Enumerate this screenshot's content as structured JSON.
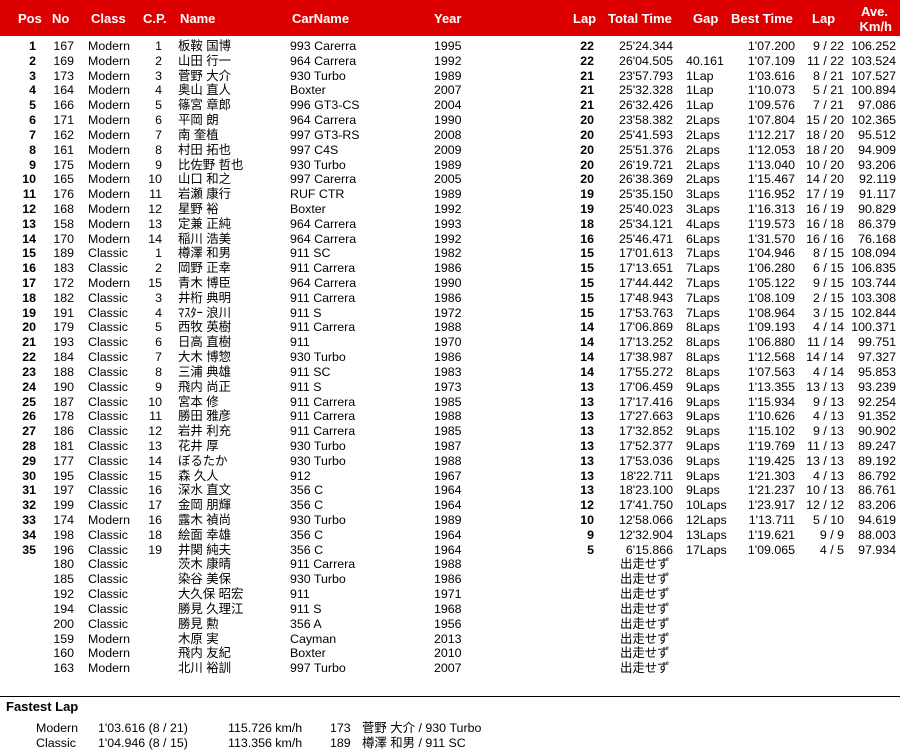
{
  "header": {
    "pos": "Pos",
    "no": "No",
    "class": "Class",
    "cp": "C.P.",
    "name": "Name",
    "car": "CarName",
    "year": "Year",
    "lap": "Lap",
    "total": "Total Time",
    "gap": "Gap",
    "best": "Best Time",
    "best_lap": "Lap",
    "ave1": "Ave.",
    "ave2": "Km/h"
  },
  "colors": {
    "header_bg": "#dd0000",
    "header_text": "#ffffff"
  },
  "rows": [
    {
      "pos": "1",
      "no": "167",
      "cls": "Modern",
      "cp": "1",
      "name": "板鞍 国博",
      "car": "993 Carerra",
      "year": "1995",
      "lap": "22",
      "total": "25'24.344",
      "gap": "",
      "best": "1'07.200",
      "lapn": "9 / 22",
      "ave": "106.252"
    },
    {
      "pos": "2",
      "no": "169",
      "cls": "Modern",
      "cp": "2",
      "name": "山田 行一",
      "car": "964 Carrera",
      "year": "1992",
      "lap": "22",
      "total": "26'04.505",
      "gap": "40.161",
      "best": "1'07.109",
      "lapn": "11 / 22",
      "ave": "103.524"
    },
    {
      "pos": "3",
      "no": "173",
      "cls": "Modern",
      "cp": "3",
      "name": "菅野 大介",
      "car": "930 Turbo",
      "year": "1989",
      "lap": "21",
      "total": "23'57.793",
      "gap": "1Lap",
      "best": "1'03.616",
      "lapn": "8 / 21",
      "ave": "107.527"
    },
    {
      "pos": "4",
      "no": "164",
      "cls": "Modern",
      "cp": "4",
      "name": "奥山 直人",
      "car": "Boxter",
      "year": "2007",
      "lap": "21",
      "total": "25'32.328",
      "gap": "1Lap",
      "best": "1'10.073",
      "lapn": "5 / 21",
      "ave": "100.894"
    },
    {
      "pos": "5",
      "no": "166",
      "cls": "Modern",
      "cp": "5",
      "name": "篠宮 章郎",
      "car": "996 GT3-CS",
      "year": "2004",
      "lap": "21",
      "total": "26'32.426",
      "gap": "1Lap",
      "best": "1'09.576",
      "lapn": "7 / 21",
      "ave": "97.086"
    },
    {
      "pos": "6",
      "no": "171",
      "cls": "Modern",
      "cp": "6",
      "name": "平岡 朗",
      "car": "964 Carrera",
      "year": "1990",
      "lap": "20",
      "total": "23'58.382",
      "gap": "2Laps",
      "best": "1'07.804",
      "lapn": "15 / 20",
      "ave": "102.365"
    },
    {
      "pos": "7",
      "no": "162",
      "cls": "Modern",
      "cp": "7",
      "name": "南 奎植",
      "car": "997 GT3-RS",
      "year": "2008",
      "lap": "20",
      "total": "25'41.593",
      "gap": "2Laps",
      "best": "1'12.217",
      "lapn": "18 / 20",
      "ave": "95.512"
    },
    {
      "pos": "8",
      "no": "161",
      "cls": "Modern",
      "cp": "8",
      "name": "村田 拓也",
      "car": "997 C4S",
      "year": "2009",
      "lap": "20",
      "total": "25'51.376",
      "gap": "2Laps",
      "best": "1'12.053",
      "lapn": "18 / 20",
      "ave": "94.909"
    },
    {
      "pos": "9",
      "no": "175",
      "cls": "Modern",
      "cp": "9",
      "name": "比佐野 哲也",
      "car": "930 Turbo",
      "year": "1989",
      "lap": "20",
      "total": "26'19.721",
      "gap": "2Laps",
      "best": "1'13.040",
      "lapn": "10 / 20",
      "ave": "93.206"
    },
    {
      "pos": "10",
      "no": "165",
      "cls": "Modern",
      "cp": "10",
      "name": "山口 和之",
      "car": "997 Carerra",
      "year": "2005",
      "lap": "20",
      "total": "26'38.369",
      "gap": "2Laps",
      "best": "1'15.467",
      "lapn": "14 / 20",
      "ave": "92.119"
    },
    {
      "pos": "11",
      "no": "176",
      "cls": "Modern",
      "cp": "11",
      "name": "岩瀬 康行",
      "car": "RUF CTR",
      "year": "1989",
      "lap": "19",
      "total": "25'35.150",
      "gap": "3Laps",
      "best": "1'16.952",
      "lapn": "17 / 19",
      "ave": "91.117"
    },
    {
      "pos": "12",
      "no": "168",
      "cls": "Modern",
      "cp": "12",
      "name": "星野 裕",
      "car": "Boxter",
      "year": "1992",
      "lap": "19",
      "total": "25'40.023",
      "gap": "3Laps",
      "best": "1'16.313",
      "lapn": "16 / 19",
      "ave": "90.829"
    },
    {
      "pos": "13",
      "no": "158",
      "cls": "Modern",
      "cp": "13",
      "name": "定兼 正純",
      "car": "964 Carrera",
      "year": "1993",
      "lap": "18",
      "total": "25'34.121",
      "gap": "4Laps",
      "best": "1'19.573",
      "lapn": "16 / 18",
      "ave": "86.379"
    },
    {
      "pos": "14",
      "no": "170",
      "cls": "Modern",
      "cp": "14",
      "name": "稲川 浩美",
      "car": "964 Carrera",
      "year": "1992",
      "lap": "16",
      "total": "25'46.471",
      "gap": "6Laps",
      "best": "1'31.570",
      "lapn": "16 / 16",
      "ave": "76.168"
    },
    {
      "pos": "15",
      "no": "189",
      "cls": "Classic",
      "cp": "1",
      "name": "樽澤 和男",
      "car": "911 SC",
      "year": "1982",
      "lap": "15",
      "total": "17'01.613",
      "gap": "7Laps",
      "best": "1'04.946",
      "lapn": "8 / 15",
      "ave": "108.094"
    },
    {
      "pos": "16",
      "no": "183",
      "cls": "Classic",
      "cp": "2",
      "name": "岡野 正幸",
      "car": "911 Carrera",
      "year": "1986",
      "lap": "15",
      "total": "17'13.651",
      "gap": "7Laps",
      "best": "1'06.280",
      "lapn": "6 / 15",
      "ave": "106.835"
    },
    {
      "pos": "17",
      "no": "172",
      "cls": "Modern",
      "cp": "15",
      "name": "青木 博臣",
      "car": "964 Carrera",
      "year": "1990",
      "lap": "15",
      "total": "17'44.442",
      "gap": "7Laps",
      "best": "1'05.122",
      "lapn": "9 / 15",
      "ave": "103.744"
    },
    {
      "pos": "18",
      "no": "182",
      "cls": "Classic",
      "cp": "3",
      "name": "井桁 典明",
      "car": "911 Carrera",
      "year": "1986",
      "lap": "15",
      "total": "17'48.943",
      "gap": "7Laps",
      "best": "1'08.109",
      "lapn": "2 / 15",
      "ave": "103.308"
    },
    {
      "pos": "19",
      "no": "191",
      "cls": "Classic",
      "cp": "4",
      "name": "ﾏｽﾀｰ 浪川",
      "car": "911 S",
      "year": "1972",
      "lap": "15",
      "total": "17'53.763",
      "gap": "7Laps",
      "best": "1'08.964",
      "lapn": "3 / 15",
      "ave": "102.844"
    },
    {
      "pos": "20",
      "no": "179",
      "cls": "Classic",
      "cp": "5",
      "name": "西牧 英樹",
      "car": "911 Carrera",
      "year": "1988",
      "lap": "14",
      "total": "17'06.869",
      "gap": "8Laps",
      "best": "1'09.193",
      "lapn": "4 / 14",
      "ave": "100.371"
    },
    {
      "pos": "21",
      "no": "193",
      "cls": "Classic",
      "cp": "6",
      "name": "日高 直樹",
      "car": "911",
      "year": "1970",
      "lap": "14",
      "total": "17'13.252",
      "gap": "8Laps",
      "best": "1'06.880",
      "lapn": "11 / 14",
      "ave": "99.751"
    },
    {
      "pos": "22",
      "no": "184",
      "cls": "Classic",
      "cp": "7",
      "name": "大木 博惣",
      "car": "930 Turbo",
      "year": "1986",
      "lap": "14",
      "total": "17'38.987",
      "gap": "8Laps",
      "best": "1'12.568",
      "lapn": "14 / 14",
      "ave": "97.327"
    },
    {
      "pos": "23",
      "no": "188",
      "cls": "Classic",
      "cp": "8",
      "name": "三浦 典雄",
      "car": "911 SC",
      "year": "1983",
      "lap": "14",
      "total": "17'55.272",
      "gap": "8Laps",
      "best": "1'07.563",
      "lapn": "4 / 14",
      "ave": "95.853"
    },
    {
      "pos": "24",
      "no": "190",
      "cls": "Classic",
      "cp": "9",
      "name": "飛内 尚正",
      "car": "911 S",
      "year": "1973",
      "lap": "13",
      "total": "17'06.459",
      "gap": "9Laps",
      "best": "1'13.355",
      "lapn": "13 / 13",
      "ave": "93.239"
    },
    {
      "pos": "25",
      "no": "187",
      "cls": "Classic",
      "cp": "10",
      "name": "宮本 修",
      "car": "911 Carrera",
      "year": "1985",
      "lap": "13",
      "total": "17'17.416",
      "gap": "9Laps",
      "best": "1'15.934",
      "lapn": "9 / 13",
      "ave": "92.254"
    },
    {
      "pos": "26",
      "no": "178",
      "cls": "Classic",
      "cp": "11",
      "name": "勝田 雅彦",
      "car": "911 Carrera",
      "year": "1988",
      "lap": "13",
      "total": "17'27.663",
      "gap": "9Laps",
      "best": "1'10.626",
      "lapn": "4 / 13",
      "ave": "91.352"
    },
    {
      "pos": "27",
      "no": "186",
      "cls": "Classic",
      "cp": "12",
      "name": "岩井 利充",
      "car": "911 Carrera",
      "year": "1985",
      "lap": "13",
      "total": "17'32.852",
      "gap": "9Laps",
      "best": "1'15.102",
      "lapn": "9 / 13",
      "ave": "90.902"
    },
    {
      "pos": "28",
      "no": "181",
      "cls": "Classic",
      "cp": "13",
      "name": "花井 厚",
      "car": "930 Turbo",
      "year": "1987",
      "lap": "13",
      "total": "17'52.377",
      "gap": "9Laps",
      "best": "1'19.769",
      "lapn": "11 / 13",
      "ave": "89.247"
    },
    {
      "pos": "29",
      "no": "177",
      "cls": "Classic",
      "cp": "14",
      "name": "ぼるたか",
      "car": "930 Turbo",
      "year": "1988",
      "lap": "13",
      "total": "17'53.036",
      "gap": "9Laps",
      "best": "1'19.425",
      "lapn": "13 / 13",
      "ave": "89.192"
    },
    {
      "pos": "30",
      "no": "195",
      "cls": "Classic",
      "cp": "15",
      "name": "森 久人",
      "car": "912",
      "year": "1967",
      "lap": "13",
      "total": "18'22.711",
      "gap": "9Laps",
      "best": "1'21.303",
      "lapn": "4 / 13",
      "ave": "86.792"
    },
    {
      "pos": "31",
      "no": "197",
      "cls": "Classic",
      "cp": "16",
      "name": "深水 直文",
      "car": "356 C",
      "year": "1964",
      "lap": "13",
      "total": "18'23.100",
      "gap": "9Laps",
      "best": "1'21.237",
      "lapn": "10 / 13",
      "ave": "86.761"
    },
    {
      "pos": "32",
      "no": "199",
      "cls": "Classic",
      "cp": "17",
      "name": "金岡 朋輝",
      "car": "356 C",
      "year": "1964",
      "lap": "12",
      "total": "17'41.750",
      "gap": "10Laps",
      "best": "1'23.917",
      "lapn": "12 / 12",
      "ave": "83.206"
    },
    {
      "pos": "33",
      "no": "174",
      "cls": "Modern",
      "cp": "16",
      "name": "露木 禎尚",
      "car": "930 Turbo",
      "year": "1989",
      "lap": "10",
      "total": "12'58.066",
      "gap": "12Laps",
      "best": "1'13.711",
      "lapn": "5 / 10",
      "ave": "94.619"
    },
    {
      "pos": "34",
      "no": "198",
      "cls": "Classic",
      "cp": "18",
      "name": "絵面 幸雄",
      "car": "356 C",
      "year": "1964",
      "lap": "9",
      "total": "12'32.904",
      "gap": "13Laps",
      "best": "1'19.621",
      "lapn": "9 / 9",
      "ave": "88.003"
    },
    {
      "pos": "35",
      "no": "196",
      "cls": "Classic",
      "cp": "19",
      "name": "井関 純夫",
      "car": "356 C",
      "year": "1964",
      "lap": "5",
      "total": "6'15.866",
      "gap": "17Laps",
      "best": "1'09.065",
      "lapn": "4 / 5",
      "ave": "97.934"
    },
    {
      "pos": "",
      "no": "180",
      "cls": "Classic",
      "cp": "",
      "name": "茨木 康晴",
      "car": "911 Carrera",
      "year": "1988",
      "lap": "",
      "total": "出走せず",
      "gap": "",
      "best": "",
      "lapn": "",
      "ave": ""
    },
    {
      "pos": "",
      "no": "185",
      "cls": "Classic",
      "cp": "",
      "name": "染谷 美保",
      "car": "930 Turbo",
      "year": "1986",
      "lap": "",
      "total": "出走せず",
      "gap": "",
      "best": "",
      "lapn": "",
      "ave": ""
    },
    {
      "pos": "",
      "no": "192",
      "cls": "Classic",
      "cp": "",
      "name": "大久保 昭宏",
      "car": "911",
      "year": "1971",
      "lap": "",
      "total": "出走せず",
      "gap": "",
      "best": "",
      "lapn": "",
      "ave": ""
    },
    {
      "pos": "",
      "no": "194",
      "cls": "Classic",
      "cp": "",
      "name": "勝見 久理江",
      "car": "911 S",
      "year": "1968",
      "lap": "",
      "total": "出走せず",
      "gap": "",
      "best": "",
      "lapn": "",
      "ave": ""
    },
    {
      "pos": "",
      "no": "200",
      "cls": "Classic",
      "cp": "",
      "name": "勝見 勲",
      "car": "356 A",
      "year": "1956",
      "lap": "",
      "total": "出走せず",
      "gap": "",
      "best": "",
      "lapn": "",
      "ave": ""
    },
    {
      "pos": "",
      "no": "159",
      "cls": "Modern",
      "cp": "",
      "name": "木原 実",
      "car": "Cayman",
      "year": "2013",
      "lap": "",
      "total": "出走せず",
      "gap": "",
      "best": "",
      "lapn": "",
      "ave": ""
    },
    {
      "pos": "",
      "no": "160",
      "cls": "Modern",
      "cp": "",
      "name": "飛内 友紀",
      "car": "Boxter",
      "year": "2010",
      "lap": "",
      "total": "出走せず",
      "gap": "",
      "best": "",
      "lapn": "",
      "ave": ""
    },
    {
      "pos": "",
      "no": "163",
      "cls": "Modern",
      "cp": "",
      "name": "北川 裕訓",
      "car": "997 Turbo",
      "year": "2007",
      "lap": "",
      "total": "出走せず",
      "gap": "",
      "best": "",
      "lapn": "",
      "ave": ""
    }
  ],
  "fastest_lap": {
    "title": "Fastest Lap",
    "entries": [
      {
        "cls": "Modern",
        "time": "1'03.616 (8 / 21)",
        "speed": "115.726 km/h",
        "no": "173",
        "driver": "菅野 大介 / 930 Turbo"
      },
      {
        "cls": "Classic",
        "time": "1'04.946 (8 / 15)",
        "speed": "113.356 km/h",
        "no": "189",
        "driver": "樽澤 和男 / 911 SC"
      }
    ]
  }
}
